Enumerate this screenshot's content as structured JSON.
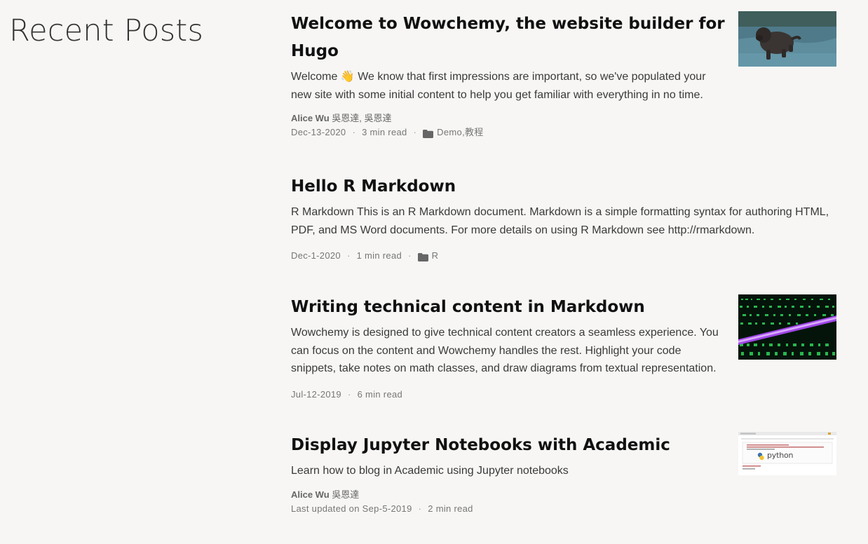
{
  "page": {
    "heading": "Recent Posts"
  },
  "posts": [
    {
      "title": "Welcome to Wowchemy, the website builder for Hugo",
      "summary": "Welcome 👋 We know that first impressions are important, so we've populated your new site with some initial content to help you get familiar with everything in no time.",
      "author_primary": "Alice Wu",
      "author_rest": " 吳恩達, 吳恩達",
      "date": "Dec-13-2020",
      "read_time": "3 min read",
      "categories": [
        "Demo",
        "教程"
      ],
      "categories_sep": ", ",
      "thumbnail_icon": "dog-photo-thumbnail"
    },
    {
      "title": "Hello R Markdown",
      "summary": "R Markdown This is an R Markdown document. Markdown is a simple formatting syntax for authoring HTML, PDF, and MS Word documents. For more details on using R Markdown see http://rmarkdown.",
      "date": "Dec-1-2020",
      "read_time": "1 min read",
      "categories": [
        "R"
      ]
    },
    {
      "title": "Writing technical content in Markdown",
      "summary": "Wowchemy is designed to give technical content creators a seamless experience. You can focus on the content and Wowchemy handles the rest. Highlight your code snippets, take notes on math classes, and draw diagrams from textual representation.",
      "date": "Jul-12-2019",
      "read_time": "6 min read",
      "thumbnail_icon": "matrix-code-thumbnail"
    },
    {
      "title": "Display Jupyter Notebooks with Academic",
      "summary": "Learn how to blog in Academic using Jupyter notebooks",
      "author_primary": "Alice Wu",
      "author_rest": " 吳恩達",
      "date": "Last updated on Sep-5-2019",
      "read_time": "2 min read",
      "thumbnail_icon": "jupyter-notebook-thumbnail",
      "thumbnail_text": "python"
    }
  ],
  "meta": {
    "separator": "·"
  },
  "colors": {
    "background": "#f7f6f4",
    "title": "#111111",
    "body_text": "#3a3a3a",
    "meta_text": "#777777",
    "matrix_green": "#2fd35a",
    "matrix_purple": "#b04bff"
  }
}
